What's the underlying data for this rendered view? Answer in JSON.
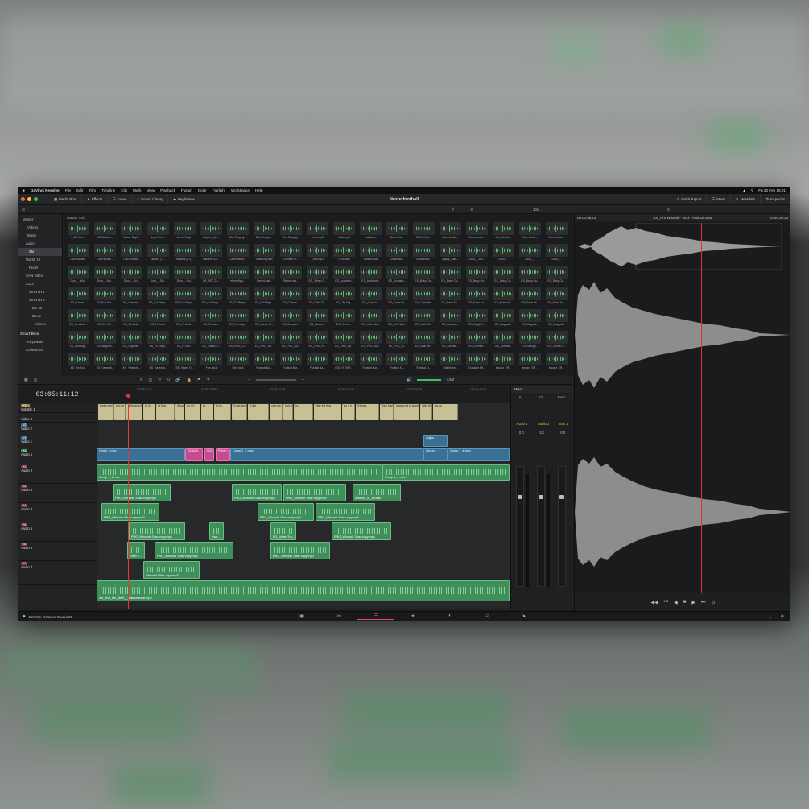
{
  "menubar": {
    "apple": "",
    "app_name": "DaVinci Resolve",
    "items": [
      "File",
      "Edit",
      "Trim",
      "Timeline",
      "Clip",
      "Mark",
      "View",
      "Playback",
      "Fusion",
      "Color",
      "Fairlight",
      "Workspace",
      "Help"
    ],
    "clock": "Fri 20 Feb 15:01"
  },
  "toolbar": {
    "media_pool": "Media Pool",
    "effects": "Effects",
    "index": "Index",
    "sound_library": "Sound Library",
    "keyframes": "Keyframes",
    "project_title": "Nexte football",
    "quick_export": "Quick Export",
    "mixer": "Mixer",
    "metadata": "Metadata",
    "inspector": "Inspector"
  },
  "subbar": {
    "zoom": "10x",
    "timecode_in": "00:00:08:23",
    "clip_name": "SS_Fire Whoosh - SFX Producer.wav",
    "timecode_out": "00:00:08:10"
  },
  "bins": {
    "items": [
      "Master",
      "Videos",
      "Music",
      "audio",
      "Sfx",
      "Month 12",
      "Pedel",
      "CAN video",
      "2023",
      "MONTH 1",
      "MONTH 2",
      "Bin 52",
      "Boule",
      "videos",
      "Smart Bins",
      "Keywords",
      "Collections"
    ],
    "selected_index": 4
  },
  "media": {
    "path": "Master \\ Sfx",
    "clips": [
      "1 (98 Hum...",
      "12206 subs...",
      "Adva - Digit...",
      "Angel Feet...",
      "Arrow Engi...",
      "Asylum_Qui...",
      "Bird Singing...",
      "Bird Singing...",
      "Bird Singing...",
      "birds.mp3",
      "birds.mp3",
      "bobdown",
      "Boom Hit...",
      "BOOM Lib...",
      "Cam shutte...",
      "Cam shutte...",
      "Cam shutte...",
      "Cam shutte...",
      "Cam shutte...",
      "Cam shutte...",
      "Cam shutte...",
      "Cam Shutte...",
      "camera (7)...",
      "camera (87)...",
      "camera (92)...",
      "CameraBird...",
      "cash ring.wav",
      "Chimes SF...",
      "Click.mp3",
      "Click.wav",
      "Clicked.wav",
      "Crescendo...",
      "Crescendo...",
      "Digital_Cam...",
      "Door_...Wo...",
      "Door_...",
      "Door_...",
      "Door_...",
      "Door_...Wo...",
      "Door_...Mo...",
      "Door_...Sci...",
      "Door_...Sci...",
      "Door_...Sci...",
      "DS_INT_Ca...",
      "eberth5yw...",
      "DeserLake...",
      "Dieme ods...",
      "ES_30mm C...",
      "ES_Accident...",
      "ES_Accident...",
      "ES_Acoustic...",
      "ES_Baby Ca...",
      "ES_Baby Ca...",
      "ES_Baby Ca...",
      "ES_Baby Ca...",
      "ES_Baby Ca...",
      "ES_Baby Ca...",
      "ES_Barber...",
      "ES_Bull Gra...",
      "ES_Camera...",
      "ES_Cd Playe...",
      "ES_Cd Playe...",
      "ES_Cd Playe...",
      "ES_CD Playe...",
      "ES_Cd Playe...",
      "ES_Chimes...",
      "ES_Child Gi...",
      "ES_City Nig...",
      "ES_Coin Dr...",
      "ES_Coins Dr...",
      "ES_Concrete...",
      "ES_Farm An...",
      "ES_Farm An...",
      "ES_Farm An...",
      "ES_Farm An...",
      "ES_Farm An...",
      "ES_Feedbac...",
      "ES_Fire Wh...",
      "ES_Fireball...",
      "ES_Fireball...",
      "ES_Fireball...",
      "ES_Firewor...",
      "ES_Fireway...",
      "ES_Game Fi...",
      "ES_Group Li...",
      "ES_Harbor...",
      "ES_Harbor...",
      "ES_Kids Wal...",
      "ES_Kids Wal...",
      "ES_Knife Cl...",
      "ES_Las Veg...",
      "ES_Magic F...",
      "ES_Magical...",
      "ES_Magical...",
      "ES_Magical...",
      "ES_Morning...",
      "ES_Neighbo...",
      "ES_Organic...",
      "ES_Ps Keyb...",
      "ES_Pl Whi...",
      "ES_Plastic B...",
      "ES_PRO_CI...",
      "ES_PRO_Gu...",
      "ES_PRO_Gu...",
      "ES_PRO_Hi...",
      "ES_PRO_Sp...",
      "ES_PRO_Su...",
      "ES_PRO_W...",
      "ES_Rain Wi...",
      "ES_Sunrise...",
      "ES_Sunrise...",
      "ES_Surreal...",
      "ES_Swinge...",
      "ES_Tennis B...",
      "ES_Tin Sol...",
      "ES_Typewrit...",
      "ES_Typewrit...",
      "ES_Typewrit...",
      "ES_Water Tr...",
      "Fire.mp3",
      "Film.mp3",
      "Footbal Bur...",
      "Footbal Bur...",
      "Footbal Ba...",
      "FOLEY_SFX...",
      "Footbal Bur...",
      "Footbal Ki...",
      "Footbal Ki...",
      "Glitchtone...",
      "Gunshot Eff...",
      "impact_ER...",
      "impact_ER...",
      "impact_ER..."
    ]
  },
  "timeline": {
    "timecode": "03:05:11:12",
    "ruler": [
      "03:05:11:12",
      "03:05:15:00",
      "03:05:24:08",
      "03:05:32:16",
      "03:05:38:28",
      "03:05:42:00"
    ],
    "dim": "DIM",
    "tracks": [
      {
        "tag": "ST1",
        "name": "Subtitle 1",
        "color": "#a88b3f"
      },
      {
        "tag": "",
        "name": "Video 3",
        "color": "#3a6f96"
      },
      {
        "tag": "V2",
        "name": "Video 2",
        "color": "#3a6f96"
      },
      {
        "tag": "V1",
        "name": "Video 1",
        "color": "#3a6f96"
      },
      {
        "tag": "A1",
        "name": "Audio 1",
        "color": "#3a8f54"
      },
      {
        "tag": "A2",
        "name": "Audio 2",
        "color": "#8a3a3a"
      },
      {
        "tag": "A3",
        "name": "Audio 3",
        "color": "#8a3a3a"
      },
      {
        "tag": "A4",
        "name": "Audio 4",
        "color": "#8a3a3a"
      },
      {
        "tag": "A5",
        "name": "Audio 5",
        "color": "#8a3a3a"
      },
      {
        "tag": "A6",
        "name": "Audio 6",
        "color": "#8a3a3a"
      },
      {
        "tag": "A7",
        "name": "Audio 7",
        "color": "#8a3a3a"
      }
    ],
    "subtitles": [
      "proba ably did her",
      "but her",
      "Bree ama li...",
      "to Vi",
      "W that",
      "W was 20",
      "an d it",
      "W",
      "W he",
      "it was obvio us",
      "in the",
      "only two",
      "and just st...",
      "is a",
      "after the first",
      "An d it",
      "if it was",
      "Real Madr...",
      "manag ed to score...",
      "After that night,",
      "aw as"
    ],
    "video_clips": [
      "Comp 1.mov",
      "GOALS...",
      "GO...",
      "Fimen...",
      "Comp 1_2.mov",
      "Group...",
      "Comp 1_4.mov",
      "Adjus..."
    ],
    "audio": {
      "a1": [
        "Comp 1_1.mov",
        "Comp 1_1.mov"
      ],
      "a2": [
        "PRO_Whoosh Slow copy.mp3",
        "PRO_Whoosh Slow copy.mp3",
        "PRO_Whoosh Slow copy.mp3",
        "whoosh_in_30.wav"
      ],
      "a3": [
        "PRO_Whoosh Slow copy.mp3",
        "PRO_Whoosh Slow copy.mp3",
        "PRO_Whoosh Slow copy.mp3"
      ],
      "a4": [
        "PRO_Whoosh Slow copy.mp3",
        "Swo...",
        "ES_Water Tra...",
        "PRO_Whoosh Slow copy.mp3"
      ],
      "a5": [
        "Riser 1...",
        "PRO_Whoosh Slow copy.mp3",
        "PRO_Whoosh Slow copy.mp3"
      ],
      "a6": [
        "Whoosh Filter copy.mp3"
      ],
      "a7": [
        "me_and_the_devil_-_instrumental.mp3"
      ]
    }
  },
  "mixer": {
    "title": "Mixer",
    "channels": [
      "A1",
      "A2",
      "Bus1"
    ],
    "strip_labels": [
      "Audio 1",
      "Audio 2",
      "Bus 1"
    ],
    "db_a1": "0.0",
    "db_a2": "0.0",
    "db_bus": "0.0"
  },
  "status": {
    "product": "DaVinci Resolve Studio 20"
  },
  "colors": {
    "accent": "#e94b6a",
    "audio_clip": "#3f8f5a",
    "video_clip": "#3a6f96",
    "subtitle": "#c9bf95",
    "playhead": "#dd3333"
  }
}
